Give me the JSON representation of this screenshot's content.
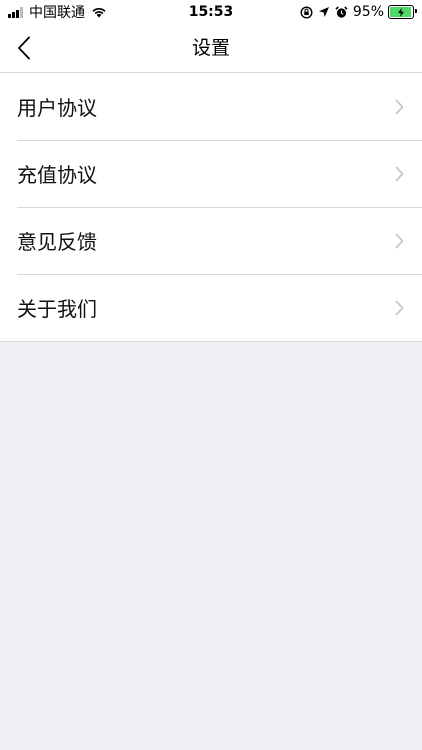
{
  "status_bar": {
    "carrier": "中国联通",
    "time": "15:53",
    "battery_percent": "95%",
    "battery_level": 0.95,
    "battery_color": "#4cd964"
  },
  "nav": {
    "title": "设置",
    "back_icon": "chevron-left-icon"
  },
  "settings": {
    "items": [
      {
        "label": "用户协议",
        "icon": "chevron-right-icon"
      },
      {
        "label": "充值协议",
        "icon": "chevron-right-icon"
      },
      {
        "label": "意见反馈",
        "icon": "chevron-right-icon"
      },
      {
        "label": "关于我们",
        "icon": "chevron-right-icon"
      }
    ]
  },
  "colors": {
    "background": "#efeff4",
    "surface": "#ffffff",
    "separator": "#d9d9d9",
    "chevron": "#c7c7cc"
  }
}
